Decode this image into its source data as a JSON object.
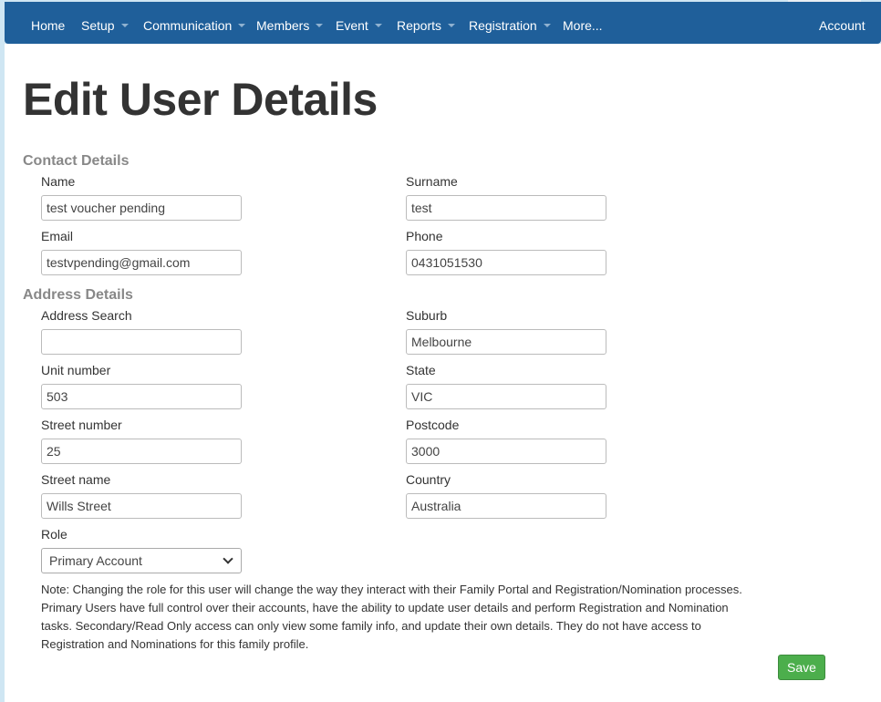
{
  "nav": {
    "home": "Home",
    "setup": "Setup",
    "communication": "Communication",
    "members": "Members",
    "event": "Event",
    "reports": "Reports",
    "registration": "Registration",
    "more": "More...",
    "account": "Account"
  },
  "page": {
    "title": "Edit User Details"
  },
  "contact": {
    "heading": "Contact Details",
    "name_label": "Name",
    "name_value": "test voucher pending",
    "surname_label": "Surname",
    "surname_value": "test",
    "email_label": "Email",
    "email_value": "testvpending@gmail.com",
    "phone_label": "Phone",
    "phone_value": "0431051530"
  },
  "address": {
    "heading": "Address Details",
    "search_label": "Address Search",
    "search_value": "",
    "suburb_label": "Suburb",
    "suburb_value": "Melbourne",
    "unit_label": "Unit number",
    "unit_value": "503",
    "state_label": "State",
    "state_value": "VIC",
    "street_number_label": "Street number",
    "street_number_value": "25",
    "postcode_label": "Postcode",
    "postcode_value": "3000",
    "street_name_label": "Street name",
    "street_name_value": "Wills Street",
    "country_label": "Country",
    "country_value": "Australia"
  },
  "role": {
    "label": "Role",
    "selected": "Primary Account",
    "note": "Note: Changing the role for this user will change the way they interact with their Family Portal and Registration/Nomination processes. Primary Users have full control over their accounts, have the ability to update user details and perform Registration and Nomination tasks. Secondary/Read Only access can only view some family info, and update their own details. They do not have access to Registration and Nominations for this family profile."
  },
  "actions": {
    "save_label": "Save"
  },
  "colors": {
    "navbar": "#1f5f9a",
    "save": "#4cae4c",
    "section_heading": "#888888"
  }
}
